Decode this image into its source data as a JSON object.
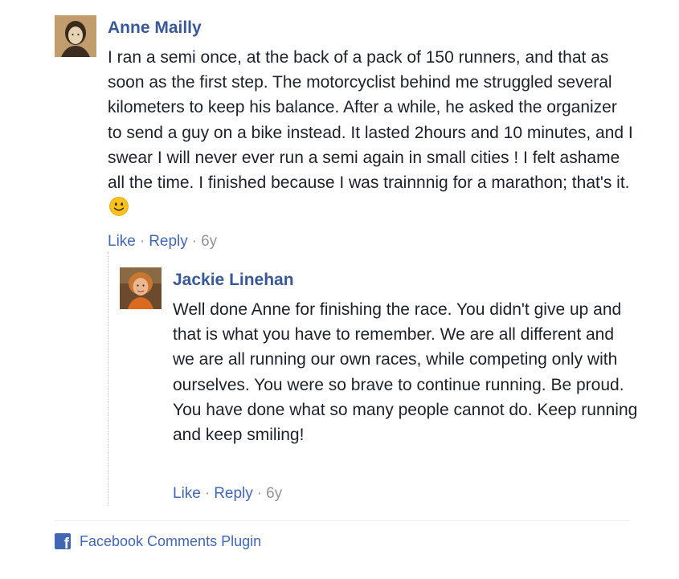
{
  "comments": [
    {
      "author": "Anne Mailly",
      "text": "I ran a semi once, at the back of a pack of 150 runners, and that as soon as the first step. The motorcyclist behind me struggled several kilometers to keep his balance. After a while, he asked the organizer to send a guy on a bike instead. It lasted 2hours and 10 minutes, and I swear I will never ever run a semi again in small cities ! I felt ashame all the time. I finished because I was trainnnig for a marathon; that's it.",
      "emoji": "slightly-smiling-face",
      "like_label": "Like",
      "reply_label": "Reply",
      "time": "6y"
    },
    {
      "author": "Jackie Linehan",
      "text": "Well done Anne for finishing the race. You didn't give up and that is what you have to remember. We are all different and we are all running our own races, while competing only with ourselves. You were so brave to continue running. Be proud. You have done what so many people cannot do. Keep running and keep smiling!",
      "like_label": "Like",
      "reply_label": "Reply",
      "time": "6y"
    }
  ],
  "separator": "·",
  "footer": {
    "icon": "facebook-icon",
    "label": "Facebook Comments Plugin"
  },
  "colors": {
    "author": "#385898",
    "link": "#4267b2",
    "muted": "#90949c",
    "text": "#1d2129"
  }
}
